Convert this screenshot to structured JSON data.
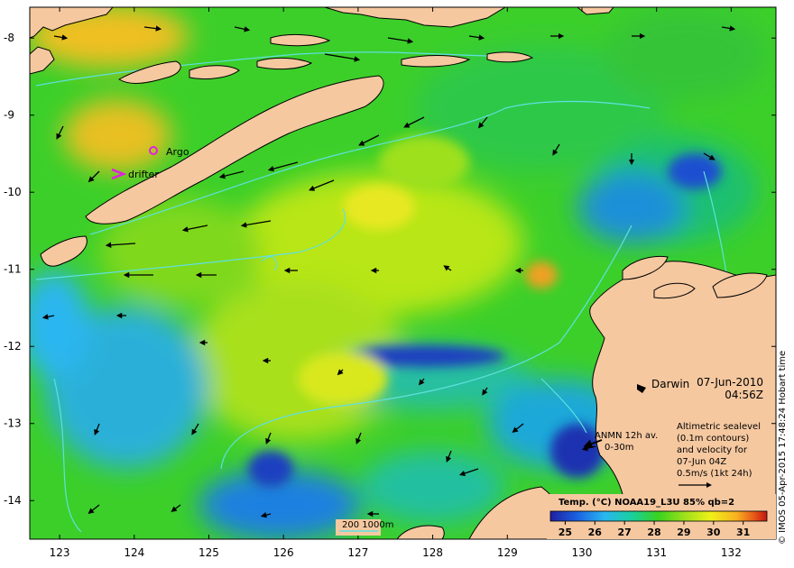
{
  "map": {
    "lat_ticks": [
      "-8",
      "-9",
      "-10",
      "-11",
      "-12",
      "-13",
      "-14"
    ],
    "lon_ticks": [
      "123",
      "124",
      "125",
      "126",
      "127",
      "128",
      "129",
      "130",
      "131",
      "132"
    ],
    "lat_range": [
      -14.5,
      -7.6
    ],
    "lon_range": [
      122.6,
      132.6
    ]
  },
  "markers": {
    "argo": "Argo",
    "drifter": "drifter"
  },
  "place": {
    "darwin": "Darwin"
  },
  "timestamp": {
    "date": "07-Jun-2010",
    "time": "04:56Z"
  },
  "anmn": {
    "line1": "ANMN 12h av.",
    "line2": "0-30m"
  },
  "altimetry": {
    "lines": [
      "Altimetric sealevel",
      "(0.1m contours)",
      "and velocity for",
      "07-Jun 04Z",
      "0.5m/s (1kt 24h)"
    ]
  },
  "bathy_legend": {
    "label": "200  1000m"
  },
  "colorbar": {
    "title": "Temp. (°C) NOAA19_L3U 85% qb=2",
    "ticks": [
      "25",
      "26",
      "27",
      "28",
      "29",
      "30",
      "31"
    ],
    "min": 24.5,
    "max": 31.8
  },
  "credit": "© IMOS 05-Apr-2015 17:48:24 Hobart time",
  "colors": {
    "land": "#f5c8a0",
    "sst_scale": [
      "#1f1fa0",
      "#1a60e0",
      "#29b6f0",
      "#18d09a",
      "#3ad21e",
      "#9ee01a",
      "#f0f018",
      "#f8b020",
      "#e85818",
      "#c01810"
    ],
    "contour": "#5fe0e0",
    "marker": "#e020e0"
  }
}
